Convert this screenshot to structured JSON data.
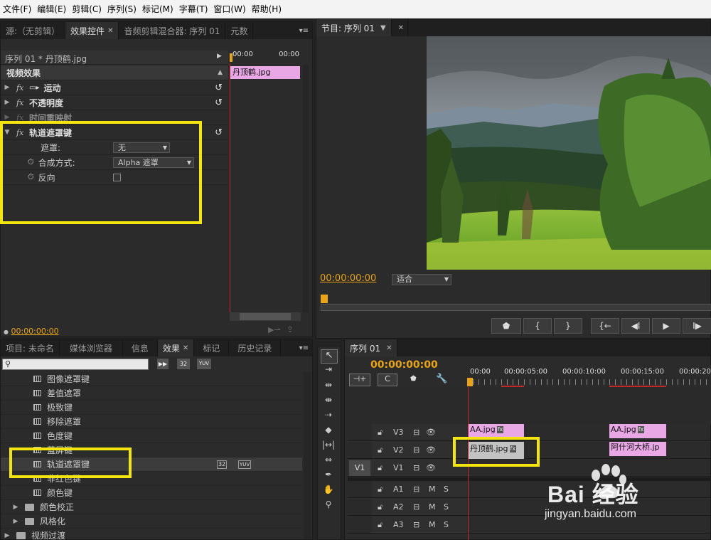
{
  "menu": [
    "文件(F)",
    "编辑(E)",
    "剪辑(C)",
    "序列(S)",
    "标记(M)",
    "字幕(T)",
    "窗口(W)",
    "帮助(H)"
  ],
  "source_panel": {
    "tabs": [
      "源:（无剪辑）",
      "效果控件",
      "音频剪辑混合器: 序列 01",
      "元数"
    ],
    "header": "序列 01 * 丹顶鹤.jpg",
    "ruler_left": "00:00",
    "ruler_right": "00:00",
    "clip": "丹顶鹤.jpg",
    "section": "视频效果",
    "effects": [
      "运动",
      "不透明度",
      "时间重映射",
      "轨道遮罩键"
    ],
    "props": {
      "mask_label": "遮罩:",
      "mask_value": "无",
      "composite_label": "合成方式:",
      "composite_value": "Alpha 遮罩",
      "reverse_label": "反向"
    },
    "timecode": "00:00:00:00"
  },
  "program": {
    "tab": "节目: 序列 01",
    "timecode": "00:00:00:00",
    "fit": "适合"
  },
  "project_panel": {
    "tabs": [
      "项目: 未命名",
      "媒体浏览器",
      "信息",
      "效果",
      "标记",
      "历史记录"
    ],
    "items": [
      "图像遮罩键",
      "差值遮罩",
      "极致键",
      "移除遮罩",
      "色度键",
      "蓝屏键",
      "轨道遮罩键",
      "非红色键",
      "颜色键"
    ],
    "folders": [
      "颜色校正",
      "风格化",
      "视频过渡"
    ],
    "badges": [
      "32",
      "YUV"
    ]
  },
  "timeline": {
    "tab": "序列 01",
    "timecode": "00:00:00:00",
    "ruler": [
      "00:00",
      "00:00:05:00",
      "00:00:10:00",
      "00:00:15:00",
      "00:00:20:"
    ],
    "tracks": [
      "V3",
      "V2",
      "V1",
      "A1",
      "A2",
      "A3"
    ],
    "v1_label": "V1",
    "track_mute": "M",
    "track_solo": "S",
    "clips": {
      "v3a": "AA.jpg",
      "v3b": "AA.jpg",
      "v2a": "丹顶鹤.jpg",
      "v2b": "阿什河大桥.jp"
    },
    "fx_badge": "fx"
  },
  "watermark": {
    "text": "Bai 经验",
    "url": "jingyan.baidu.com"
  }
}
